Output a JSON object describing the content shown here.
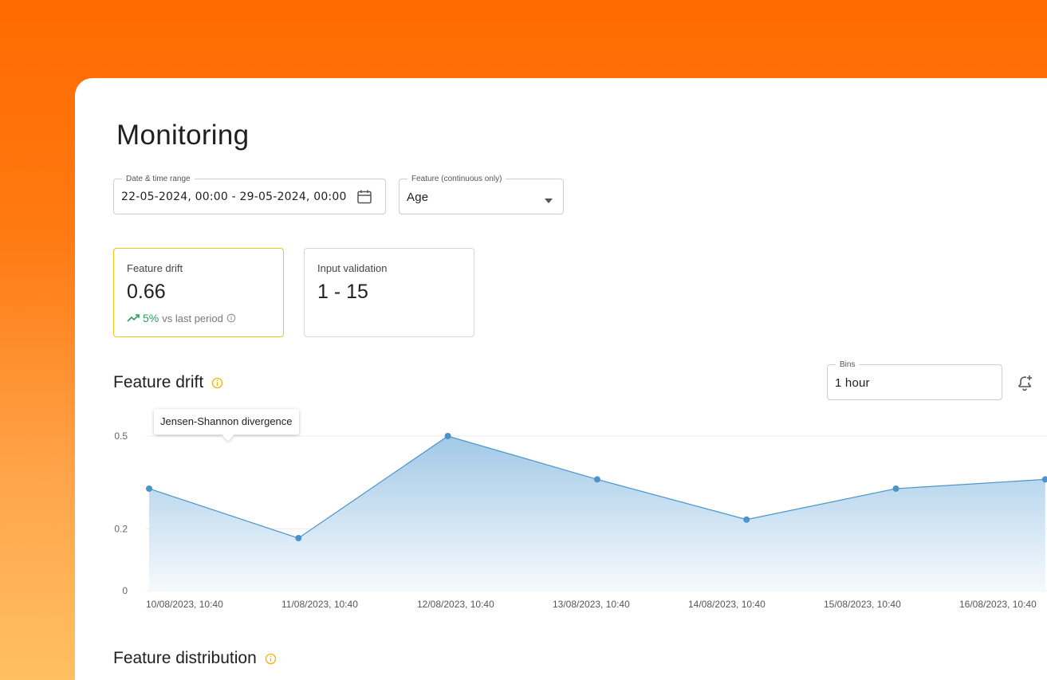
{
  "page": {
    "title": "Monitoring"
  },
  "filters": {
    "date_range": {
      "label": "Date & time range",
      "value": "22-05-2024, 00:00 - 29-05-2024, 00:00",
      "icon": "calendar-icon"
    },
    "feature": {
      "label": "Feature (continuous only)",
      "value": "Age",
      "icon": "caret-down-icon"
    }
  },
  "cards": {
    "feature_drift": {
      "label": "Feature drift",
      "value": "0.66",
      "trend_pct": "5%",
      "trend_text": "vs last period",
      "trend_icon": "trending-up-icon",
      "info_icon": "info-icon",
      "accent": "#f0c419"
    },
    "input_validation": {
      "label": "Input validation",
      "value": "1 - 15"
    }
  },
  "drift_section": {
    "title": "Feature drift",
    "info_icon": "info-icon",
    "bins": {
      "label": "Bins",
      "value": "1 hour"
    },
    "alert_icon": "add-alert-bell-icon",
    "tooltip": "Jensen-Shannon divergence"
  },
  "chart_data": {
    "type": "area",
    "x": [
      "10/08/2023, 10:40",
      "11/08/2023, 10:40",
      "12/08/2023, 10:40",
      "13/08/2023, 10:40",
      "14/08/2023, 10:40",
      "15/08/2023, 10:40",
      "16/08/2023, 10:40"
    ],
    "series": [
      {
        "values": [
          0.33,
          0.17,
          0.5,
          0.36,
          0.23,
          0.33,
          0.36
        ]
      }
    ],
    "y_ticks": [
      "0",
      "0.2",
      "0.5"
    ],
    "ylim": [
      0,
      0.5
    ],
    "colors": {
      "line": "#4a94c8",
      "fill_top": "#9cc6e6",
      "fill_bottom": "#f4f9fd",
      "point": "#4a94c8"
    },
    "grid": true
  },
  "distribution_section": {
    "title": "Feature distribution",
    "info_icon": "info-icon"
  },
  "colors": {
    "accent_info": "#f0b400",
    "background_top": "#ff6a00",
    "background_bottom": "#ffc062"
  }
}
